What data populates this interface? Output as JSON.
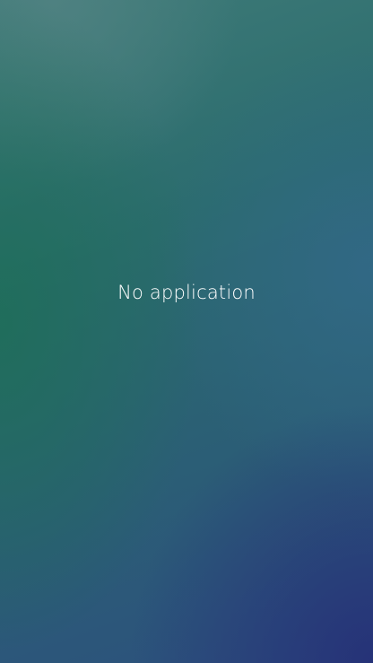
{
  "home_screen": {
    "empty_message": "No application"
  }
}
